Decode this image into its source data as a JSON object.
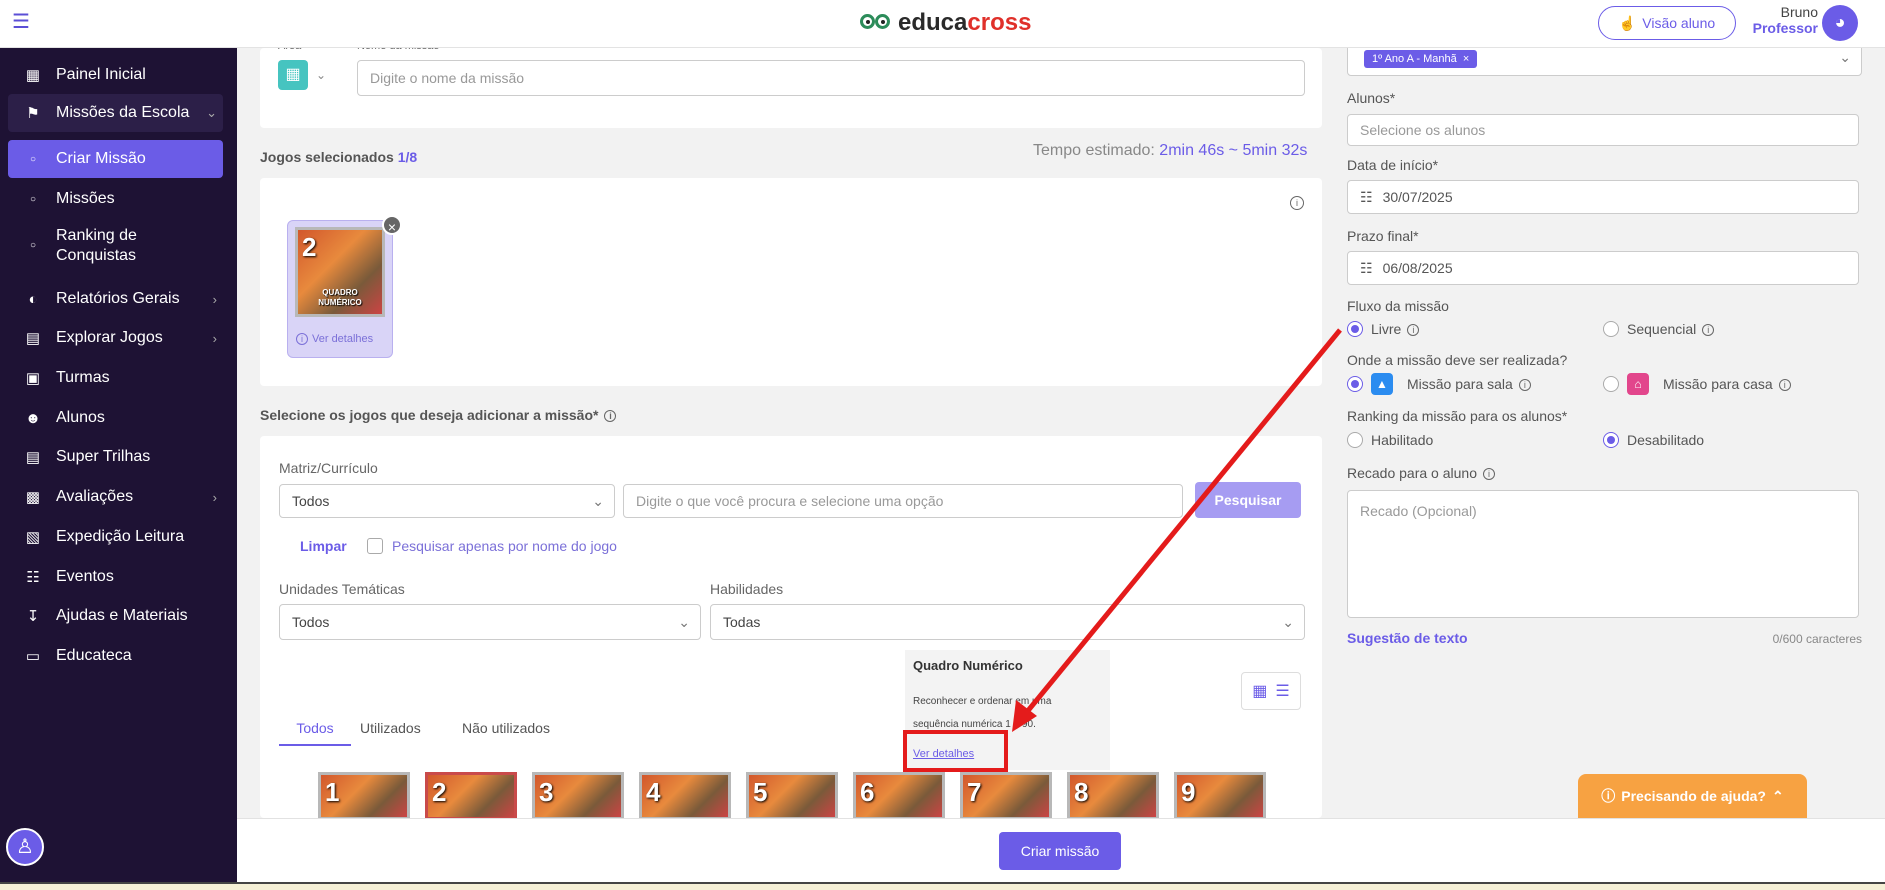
{
  "topbar": {
    "logo_part1": "educa",
    "logo_part2": "cross",
    "visao_aluno": "Visão aluno",
    "user_name": "Bruno",
    "user_role": "Professor"
  },
  "sidebar": {
    "items": [
      {
        "label": "Painel Inicial",
        "icon": "grid-icon"
      },
      {
        "label": "Missões da Escola",
        "icon": "flag-icon"
      },
      {
        "label": "Criar Missão",
        "icon": "circle-icon"
      },
      {
        "label": "Missões",
        "icon": "circle-icon"
      },
      {
        "label": "Ranking de Conquistas",
        "icon": "circle-icon"
      },
      {
        "label": "Relatórios Gerais",
        "icon": "chart-pie-icon"
      },
      {
        "label": "Explorar Jogos",
        "icon": "map-icon"
      },
      {
        "label": "Turmas",
        "icon": "briefcase-icon"
      },
      {
        "label": "Alunos",
        "icon": "users-icon"
      },
      {
        "label": "Super Trilhas",
        "icon": "book-open-icon"
      },
      {
        "label": "Avaliações",
        "icon": "clipboard-icon"
      },
      {
        "label": "Expedição Leitura",
        "icon": "book-icon"
      },
      {
        "label": "Eventos",
        "icon": "calendar-icon"
      },
      {
        "label": "Ajudas e Materiais",
        "icon": "download-icon"
      },
      {
        "label": "Educateca",
        "icon": "screen-icon"
      }
    ]
  },
  "mission": {
    "area_label": "Área",
    "name_label": "Nome da missão",
    "name_placeholder": "Digite o nome da missão"
  },
  "selected_games": {
    "title": "Jogos selecionados",
    "count": "1/8",
    "time_label": "Tempo estimado:",
    "time_value": "2min 46s ~ 5min 32s",
    "game_number": "2",
    "game_title_line1": "QUADRO",
    "game_title_line2": "NUMÉRICO",
    "details_link": "Ver detalhes"
  },
  "search": {
    "section_title": "Selecione os jogos que deseja adicionar a missão*",
    "matriz_label": "Matriz/Currículo",
    "matriz_value": "Todos",
    "search_placeholder": "Digite o que você procura e selecione uma opção",
    "search_button": "Pesquisar",
    "clear": "Limpar",
    "name_only": "Pesquisar apenas por nome do jogo",
    "unidades_label": "Unidades Temáticas",
    "unidades_value": "Todos",
    "habilidades_label": "Habilidades",
    "habilidades_value": "Todas"
  },
  "tabs": [
    "Todos",
    "Utilizados",
    "Não utilizados"
  ],
  "tooltip": {
    "title": "Quadro Numérico",
    "text_line1": "Reconhecer e ordenar em uma",
    "text_line2": "sequência numérica 1 a 90.",
    "link": "Ver detalhes"
  },
  "games": [
    "1",
    "2",
    "3",
    "4",
    "5",
    "6",
    "7",
    "8",
    "9"
  ],
  "right": {
    "turma_chip": "1º Ano A - Manhã",
    "alunos_label": "Alunos*",
    "alunos_placeholder": "Selecione os alunos",
    "inicio_label": "Data de início*",
    "inicio_value": "30/07/2025",
    "prazo_label": "Prazo final*",
    "prazo_value": "06/08/2025",
    "fluxo_label": "Fluxo da missão",
    "fluxo_livre": "Livre",
    "fluxo_seq": "Sequencial",
    "onde_label": "Onde a missão deve ser realizada?",
    "onde_sala": "Missão para sala",
    "onde_casa": "Missão para casa",
    "ranking_label": "Ranking da missão para os alunos*",
    "ranking_on": "Habilitado",
    "ranking_off": "Desabilitado",
    "recado_label": "Recado para o aluno",
    "recado_placeholder": "Recado (Opcional)",
    "sugestao": "Sugestão de texto",
    "chars": "0/600 caracteres"
  },
  "footer": {
    "criar": "Criar missão",
    "help": "Precisando de ajuda?"
  }
}
